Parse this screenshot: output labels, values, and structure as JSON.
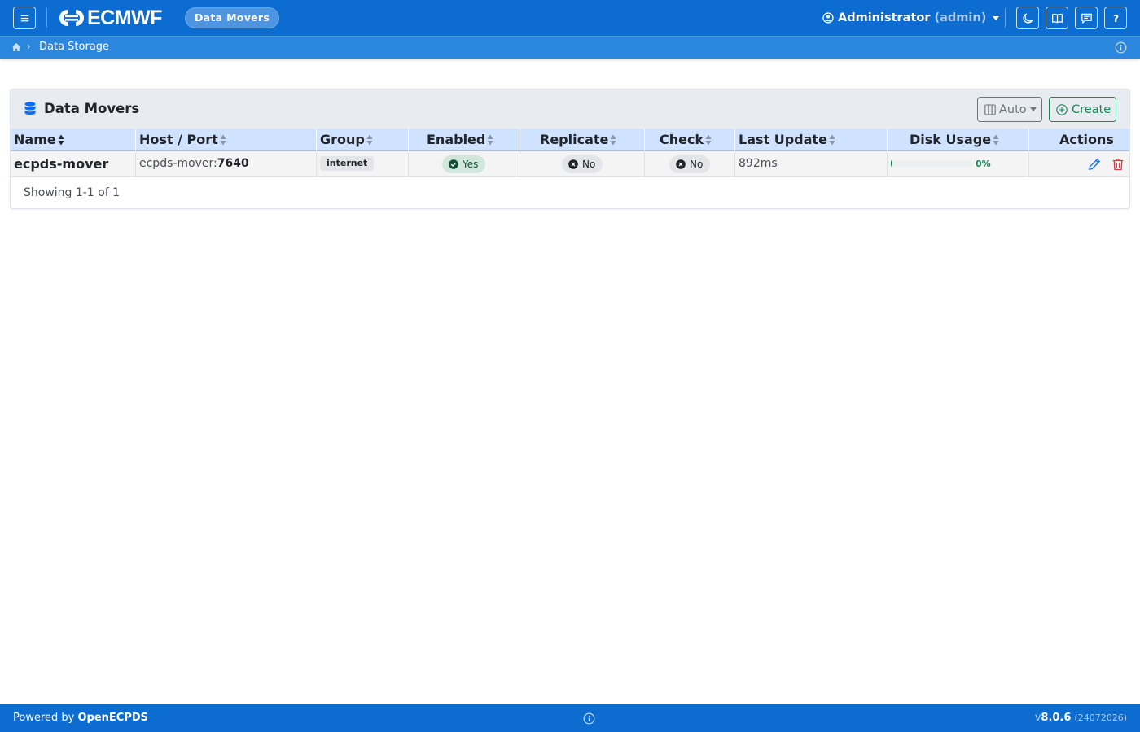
{
  "navbar": {
    "logo_text": "ECMWF",
    "app_name": "Data Movers",
    "user": {
      "name": "Administrator",
      "login": "(admin)"
    }
  },
  "breadcrumb": {
    "current": "Data Storage"
  },
  "card": {
    "title": "Data Movers",
    "auto_label": "Auto",
    "create_label": "Create"
  },
  "table": {
    "columns": [
      "Name",
      "Host / Port",
      "Group",
      "Enabled",
      "Replicate",
      "Check",
      "Last Update",
      "Disk Usage",
      "Actions"
    ],
    "rows": [
      {
        "name": "ecpds-mover",
        "host": "ecpds-mover:",
        "port": "7640",
        "group": "internet",
        "enabled": "Yes",
        "replicate": "No",
        "check": "No",
        "last_update": "892ms",
        "disk_usage": "0%",
        "disk_usage_fraction": 0.01
      }
    ]
  },
  "pagination": {
    "showing": "Showing 1-1 of 1"
  },
  "footer": {
    "powered_prefix": "Powered by ",
    "powered_name": "OpenECPDS",
    "version_prefix": "v",
    "version_number": "8.0.6",
    "build": "(24072026)"
  },
  "colors": {
    "navbar": "#0d6ccf",
    "breadcrumb": "#2b86dd",
    "table_header": "#cfe2ff",
    "success": "#198754",
    "danger": "#dc3545",
    "edit": "#0d6efd"
  },
  "icons": [
    "menu-icon",
    "ecmwf-logo-icon",
    "user-circle-icon",
    "moon-icon",
    "book-icon",
    "chat-icon",
    "help-icon",
    "home-icon",
    "info-icon",
    "database-icon",
    "columns-icon",
    "plus-circle-icon",
    "check-circle-icon",
    "x-circle-icon",
    "pencil-icon",
    "trash-icon"
  ]
}
